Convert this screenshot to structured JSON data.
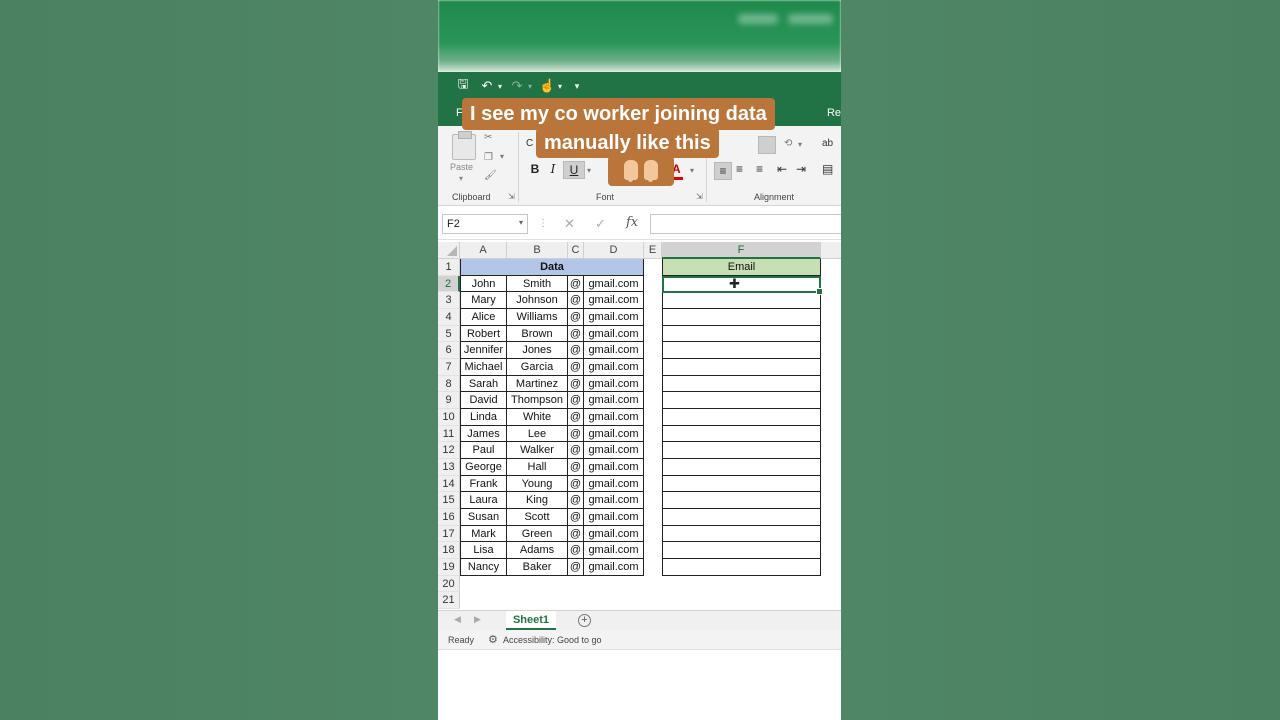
{
  "quick_access": {
    "icons": [
      "save-icon",
      "undo-icon",
      "redo-icon",
      "touch-mode-icon",
      "customize-icon"
    ]
  },
  "tabs": {
    "left_partial": "Fi",
    "right_partial": "Re"
  },
  "ribbon": {
    "clipboard": {
      "paste_label": "Paste",
      "group_label": "Clipboard"
    },
    "font": {
      "font_box_partial": "C",
      "bold": "B",
      "italic": "I",
      "underline": "U",
      "font_color": "A",
      "group_label": "Font"
    },
    "alignment": {
      "group_label": "Alignment"
    }
  },
  "overlay_caption": {
    "line1": "I see my co worker joining data",
    "line2": "manually like this",
    "emoji": "👇👇"
  },
  "formula_bar": {
    "name_box": "F2",
    "fx_label": "fx",
    "value": ""
  },
  "grid": {
    "columns": [
      "A",
      "B",
      "C",
      "D",
      "E",
      "F"
    ],
    "active_column": "F",
    "active_row": 2,
    "rows": [
      1,
      2,
      3,
      4,
      5,
      6,
      7,
      8,
      9,
      10,
      11,
      12,
      13,
      14,
      15,
      16,
      17,
      18,
      19,
      20,
      21
    ],
    "data_header": "Data",
    "email_header": "Email",
    "records": [
      {
        "first": "John",
        "last": "Smith",
        "at": "@",
        "domain": "gmail.com"
      },
      {
        "first": "Mary",
        "last": "Johnson",
        "at": "@",
        "domain": "gmail.com"
      },
      {
        "first": "Alice",
        "last": "Williams",
        "at": "@",
        "domain": "gmail.com"
      },
      {
        "first": "Robert",
        "last": "Brown",
        "at": "@",
        "domain": "gmail.com"
      },
      {
        "first": "Jennifer",
        "last": "Jones",
        "at": "@",
        "domain": "gmail.com"
      },
      {
        "first": "Michael",
        "last": "Garcia",
        "at": "@",
        "domain": "gmail.com"
      },
      {
        "first": "Sarah",
        "last": "Martinez",
        "at": "@",
        "domain": "gmail.com"
      },
      {
        "first": "David",
        "last": "Thompson",
        "at": "@",
        "domain": "gmail.com"
      },
      {
        "first": "Linda",
        "last": "White",
        "at": "@",
        "domain": "gmail.com"
      },
      {
        "first": "James",
        "last": "Lee",
        "at": "@",
        "domain": "gmail.com"
      },
      {
        "first": "Paul",
        "last": "Walker",
        "at": "@",
        "domain": "gmail.com"
      },
      {
        "first": "George",
        "last": "Hall",
        "at": "@",
        "domain": "gmail.com"
      },
      {
        "first": "Frank",
        "last": "Young",
        "at": "@",
        "domain": "gmail.com"
      },
      {
        "first": "Laura",
        "last": "King",
        "at": "@",
        "domain": "gmail.com"
      },
      {
        "first": "Susan",
        "last": "Scott",
        "at": "@",
        "domain": "gmail.com"
      },
      {
        "first": "Mark",
        "last": "Green",
        "at": "@",
        "domain": "gmail.com"
      },
      {
        "first": "Lisa",
        "last": "Adams",
        "at": "@",
        "domain": "gmail.com"
      },
      {
        "first": "Nancy",
        "last": "Baker",
        "at": "@",
        "domain": "gmail.com"
      }
    ]
  },
  "sheet_tabs": {
    "active": "Sheet1",
    "add_icon": "plus-circle-icon"
  },
  "status_bar": {
    "ready": "Ready",
    "accessibility": "Accessibility: Good to go"
  },
  "colors": {
    "excel_green": "#217346",
    "data_header_bg": "#b4c6e7",
    "email_header_bg": "#c6e0b4",
    "caption_bg": "#b9753a",
    "background": "#4e8463"
  }
}
